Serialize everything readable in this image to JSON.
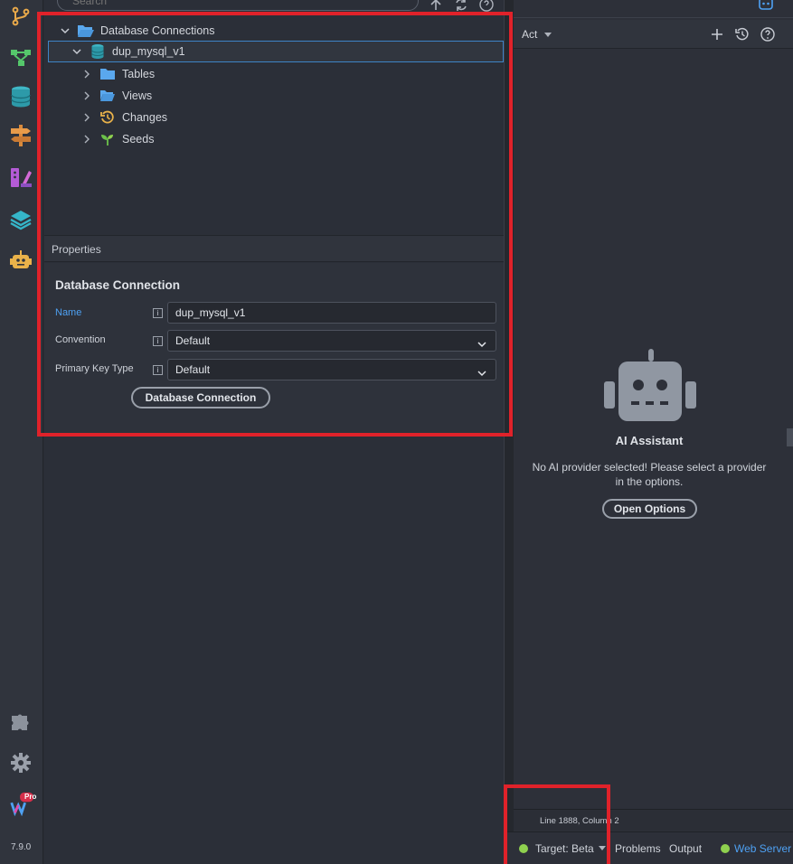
{
  "app": {
    "version": "7.9.0",
    "pro_badge": "Pro"
  },
  "search": {
    "placeholder": "Search"
  },
  "tree": {
    "root": {
      "label": "Database Connections"
    },
    "connection": {
      "label": "dup_mysql_v1"
    },
    "children": [
      {
        "label": "Tables",
        "icon": "folder-icon"
      },
      {
        "label": "Views",
        "icon": "folder-open-icon"
      },
      {
        "label": "Changes",
        "icon": "history-icon"
      },
      {
        "label": "Seeds",
        "icon": "sprout-icon"
      }
    ]
  },
  "properties": {
    "header": "Properties",
    "title": "Database Connection",
    "fields": {
      "name": {
        "label": "Name",
        "value": "dup_mysql_v1"
      },
      "convention": {
        "label": "Convention",
        "value": "Default"
      },
      "primary_key_type": {
        "label": "Primary Key Type",
        "value": "Default"
      }
    },
    "button_label": "Database Connection"
  },
  "right_panel": {
    "mode_label": "Act",
    "ai_title": "AI Assistant",
    "ai_message": "No AI provider selected! Please select a provider in the options.",
    "open_options_label": "Open Options"
  },
  "status": {
    "cursor_position": "Line 1888, Column 2",
    "target_label": "Target: Beta",
    "problems_label": "Problems",
    "output_label": "Output",
    "web_server_label": "Web Server"
  },
  "colors": {
    "accent_blue": "#4ea1f3",
    "status_green": "#8fd14f",
    "annotation_red": "#e0222a"
  }
}
